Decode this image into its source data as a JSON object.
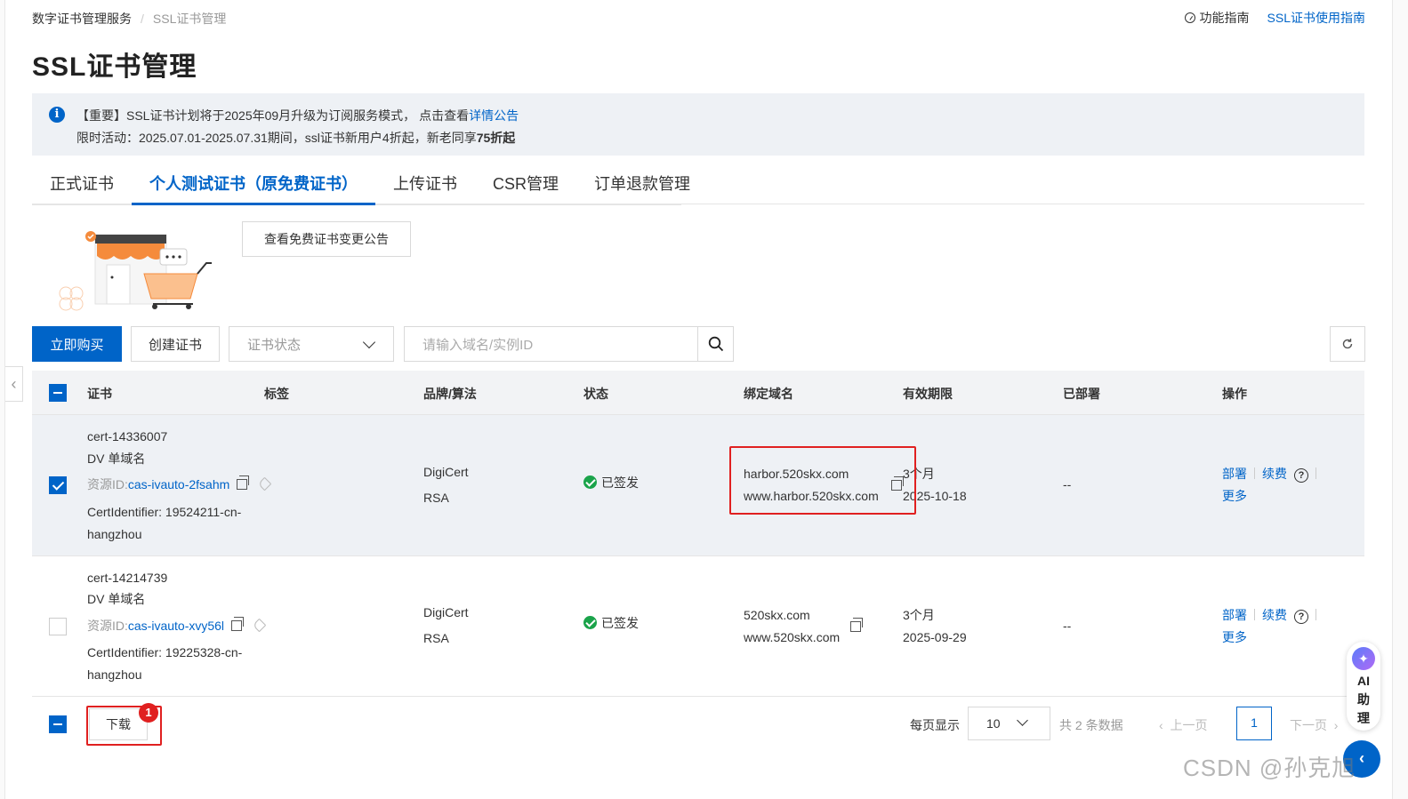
{
  "breadcrumb": {
    "root": "数字证书管理服务",
    "separator": "/",
    "current": "SSL证书管理"
  },
  "top_links": {
    "guide": "功能指南",
    "usage": "SSL证书使用指南"
  },
  "page_title": "SSL证书管理",
  "notice": {
    "line1_prefix": "【重要】SSL证书计划将于2025年09月升级为订阅服务模式，  点击查看",
    "line1_link": "详情公告",
    "line2_prefix": "限时活动：2025.07.01-2025.07.31期间，ssl证书新用户4折起，新老同享",
    "line2_bold": "75折起"
  },
  "tabs": [
    {
      "label": "正式证书"
    },
    {
      "label": "个人测试证书（原免费证书）"
    },
    {
      "label": "上传证书"
    },
    {
      "label": "CSR管理"
    },
    {
      "label": "订单退款管理"
    }
  ],
  "notice_button": "查看免费证书变更公告",
  "toolbar": {
    "buy": "立即购买",
    "create": "创建证书",
    "status_placeholder": "证书状态",
    "search_placeholder": "请输入域名/实例ID"
  },
  "table": {
    "headers": {
      "cert": "证书",
      "tag": "标签",
      "brand": "品牌/算法",
      "status": "状态",
      "domain": "绑定域名",
      "validity": "有效期限",
      "deployed": "已部署",
      "actions": "操作"
    },
    "rows": [
      {
        "cert_id": "cert-14336007",
        "type": "DV 单域名",
        "resource_prefix": "资源ID:",
        "resource_id": "cas-ivauto-2fsahm",
        "identifier_1": "CertIdentifier: 19524211-cn-",
        "identifier_2": "hangzhou",
        "brand": "DigiCert",
        "algo": "RSA",
        "status": "已签发",
        "domain_1": "harbor.520skx.com",
        "domain_2": "www.harbor.520skx.com",
        "duration": "3个月",
        "expire": "2025-10-18",
        "deployed": "--",
        "action_deploy": "部署",
        "action_renew": "续费",
        "action_more": "更多",
        "help": "?"
      },
      {
        "cert_id": "cert-14214739",
        "type": "DV 单域名",
        "resource_prefix": "资源ID:",
        "resource_id": "cas-ivauto-xvy56l",
        "identifier_1": "CertIdentifier: 19225328-cn-",
        "identifier_2": "hangzhou",
        "brand": "DigiCert",
        "algo": "RSA",
        "status": "已签发",
        "domain_1": "520skx.com",
        "domain_2": "www.520skx.com",
        "duration": "3个月",
        "expire": "2025-09-29",
        "deployed": "--",
        "action_deploy": "部署",
        "action_renew": "续费",
        "action_more": "更多",
        "help": "?"
      }
    ]
  },
  "footer": {
    "download": "下载",
    "badge": "1",
    "per_page_label": "每页显示",
    "per_page": "10",
    "total": "共 2 条数据",
    "prev": "上一页",
    "page": "1",
    "next": "下一页"
  },
  "ai_assistant": {
    "ai": "AI",
    "c1": "助",
    "c2": "理"
  },
  "watermark": "CSDN @孙克旭",
  "colors": {
    "primary": "#0064c8",
    "success": "#1aa34a",
    "highlight": "#e02020",
    "row_selected": "#eef1f5"
  }
}
